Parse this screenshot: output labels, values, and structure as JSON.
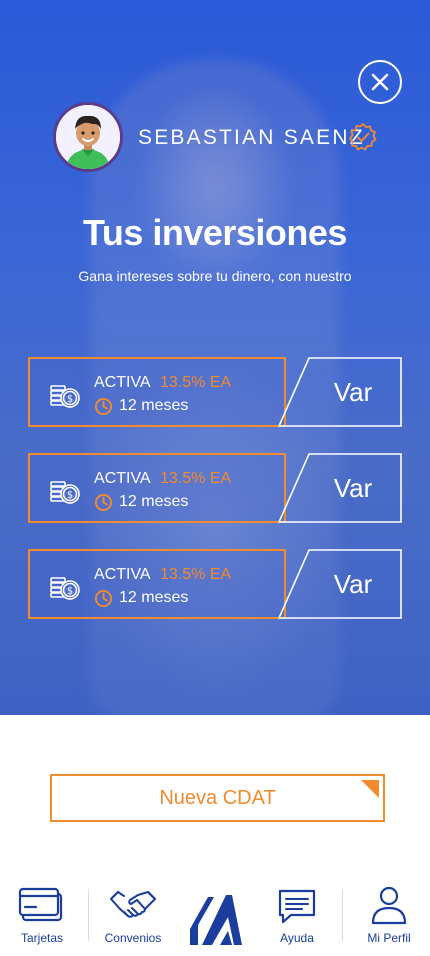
{
  "user": {
    "name": "SEBASTIAN SAENZ"
  },
  "header": {
    "title": "Tus inversiones",
    "subtitle": "Gana intereses sobre tu dinero, con nuestro"
  },
  "investments": [
    {
      "status": "ACTIVA",
      "rate": "13.5% EA",
      "term": "12 meses",
      "action": "Var"
    },
    {
      "status": "ACTIVA",
      "rate": "13.5% EA",
      "term": "12 meses",
      "action": "Var"
    },
    {
      "status": "ACTIVA",
      "rate": "13.5% EA",
      "term": "12 meses",
      "action": "Var"
    }
  ],
  "new_button": {
    "label": "Nueva CDAT"
  },
  "nav": {
    "items": [
      {
        "label": "Tarjetas",
        "icon": "card-icon"
      },
      {
        "label": "Convenios",
        "icon": "handshake-icon"
      },
      {
        "label": "",
        "icon": "brand-logo"
      },
      {
        "label": "Ayuda",
        "icon": "chat-icon"
      },
      {
        "label": "Mi Perfil",
        "icon": "user-icon"
      }
    ]
  },
  "colors": {
    "accent": "#f28a2e",
    "primary": "#1a3d9e",
    "hero": "#2a5ad8"
  }
}
